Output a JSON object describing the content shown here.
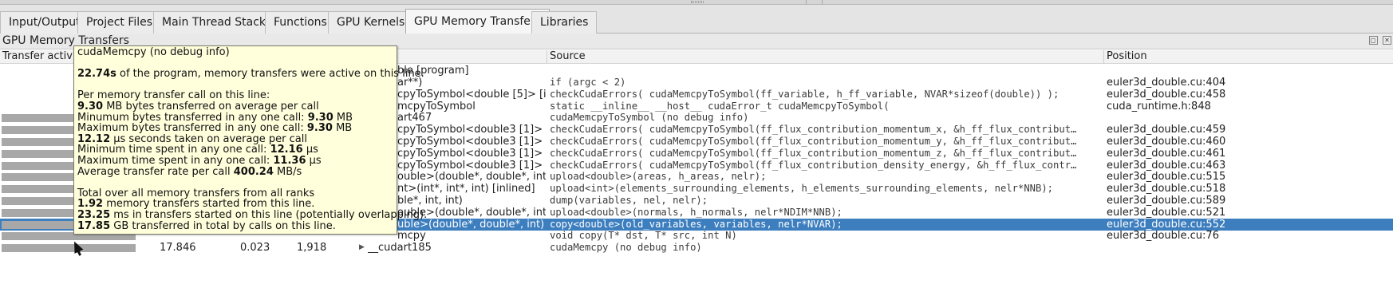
{
  "tabs": [
    {
      "label": "Input/Output"
    },
    {
      "label": "Project Files"
    },
    {
      "label": "Main Thread Stacks"
    },
    {
      "label": "Functions"
    },
    {
      "label": "GPU Kernels"
    },
    {
      "label": "GPU Memory Transfers",
      "active": true
    },
    {
      "label": "Libraries"
    }
  ],
  "panel": {
    "title": "GPU Memory Transfers"
  },
  "columns": {
    "transfer_activity": "Transfer activity",
    "source": "Source",
    "position": "Position"
  },
  "rows": [
    {
      "bar": 0,
      "func": "ble [program]",
      "source": "",
      "position": ""
    },
    {
      "bar": 0,
      "func": "ar**)",
      "source": "if (argc < 2)",
      "position": "euler3d_double.cu:404"
    },
    {
      "bar": 0,
      "func": "cpyToSymbol<double [5]> [i...",
      "source": "checkCudaErrors( cudaMemcpyToSymbol(ff_variable, h_ff_variable, NVAR*sizeof(double)) );",
      "position": "euler3d_double.cu:458"
    },
    {
      "bar": 0,
      "func": "mcpyToSymbol",
      "source": "static __inline__ __host__ cudaError_t cudaMemcpyToSymbol(",
      "position": "cuda_runtime.h:848"
    },
    {
      "bar": 0.55,
      "func": "art467",
      "source": "cudaMemcpyToSymbol (no debug info)",
      "position": ""
    },
    {
      "bar": 0.55,
      "func": "cpyToSymbol<double3 [1]> [...",
      "source": "checkCudaErrors( cudaMemcpyToSymbol(ff_flux_contribution_momentum_x, &h_ff_flux_contribut…",
      "position": "euler3d_double.cu:459"
    },
    {
      "bar": 0.55,
      "func": "cpyToSymbol<double3 [1]> [...",
      "source": "checkCudaErrors( cudaMemcpyToSymbol(ff_flux_contribution_momentum_y, &h_ff_flux_contribut…",
      "position": "euler3d_double.cu:460"
    },
    {
      "bar": 0.55,
      "func": "cpyToSymbol<double3 [1]> [...",
      "source": "checkCudaErrors( cudaMemcpyToSymbol(ff_flux_contribution_momentum_z, &h_ff_flux_contribut…",
      "position": "euler3d_double.cu:461"
    },
    {
      "bar": 0.55,
      "func": "cpyToSymbol<double3 [1]> [...",
      "source": "checkCudaErrors( cudaMemcpyToSymbol(ff_flux_contribution_density_energy, &h_ff_flux_contr…",
      "position": "euler3d_double.cu:463"
    },
    {
      "bar": 0.55,
      "func": "ouble>(double*, double*, int)",
      "source": "upload<double>(areas, h_areas, nelr);",
      "position": "euler3d_double.cu:515"
    },
    {
      "bar": 0.55,
      "func": "nt>(int*, int*, int) [inlined]",
      "source": "upload<int>(elements_surrounding_elements, h_elements_surrounding_elements, nelr*NNB);",
      "position": "euler3d_double.cu:518"
    },
    {
      "bar": 0.55,
      "func": "ble*, int, int)",
      "source": "dump(variables, nel, nelr);",
      "position": "euler3d_double.cu:589"
    },
    {
      "bar": 0.55,
      "func": "ouble>(double*, double*, int)",
      "source": "upload<double>(normals, h_normals, nelr*NDIM*NNB);",
      "position": "euler3d_double.cu:521"
    },
    {
      "bar": 0.55,
      "func": "uble>(double*, double*, int) [...",
      "source": "copy<double>(old_variables, variables, nelr*NVAR);",
      "position": "euler3d_double.cu:552",
      "selected": true
    },
    {
      "bar": 0.55,
      "func": "mcpy",
      "source": "void copy(T* dst, T* src, int N)",
      "position": "euler3d_double.cu:76"
    },
    {
      "bar": 0.55,
      "time": "17.846",
      "percent": "0.023",
      "calls": "1,918",
      "func": "__cudart185",
      "source": "cudaMemcpy (no debug info)",
      "position": ""
    }
  ],
  "tooltip": {
    "title": "cudaMemcpy (no debug info)",
    "active_val": "22.74s",
    "active_text": " of the program, memory transfers were active on this line.",
    "per_call_heading": "Per memory transfer call on this line:",
    "avg_bytes_val": "9.30",
    "avg_bytes_text": " MB bytes transferred on average per call",
    "min_bytes_text": "Minumum bytes transferred in any one call: ",
    "min_bytes_val": "9.30",
    "min_bytes_unit": " MB",
    "max_bytes_text": "Maximum bytes transferred in any one call: ",
    "max_bytes_val": "9.30",
    "max_bytes_unit": " MB",
    "avg_time_val": "12.12",
    "avg_time_text": " µs seconds taken on average per call",
    "min_time_text": "Minimum time spent in any one call: ",
    "min_time_val": "12.16",
    "min_time_unit": " µs",
    "max_time_text": "Maximum time spent in any one call: ",
    "max_time_val": "11.36",
    "max_time_unit": " µs",
    "avg_rate_text": "Average transfer rate per call ",
    "avg_rate_val": "400.24",
    "avg_rate_unit": " MB/s",
    "total_heading": "Total over all memory transfers from all ranks",
    "total_started_val": "1.92",
    "total_started_text": " memory transfers started from this line.",
    "total_ms_val": "23.25",
    "total_ms_text": " ms in transfers started on this line (potentially overlapping).",
    "total_gb_val": "17.85",
    "total_gb_text": " GB transferred in total by calls on this line."
  }
}
